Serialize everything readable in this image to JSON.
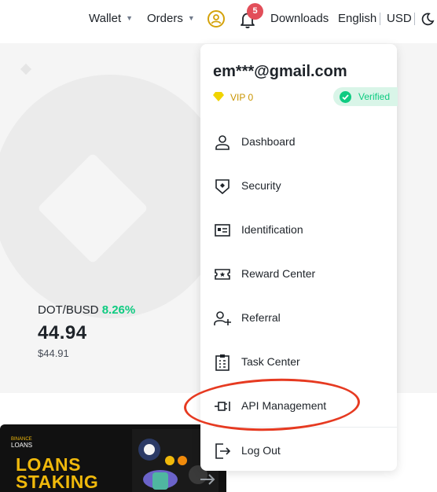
{
  "header": {
    "wallet_label": "Wallet",
    "orders_label": "Orders",
    "notification_count": "5",
    "downloads_label": "Downloads",
    "language_label": "English",
    "currency_label": "USD"
  },
  "market": {
    "pair": "DOT/BUSD",
    "change": "8.26%",
    "price": "44.94",
    "price_usd": "$44.91"
  },
  "promo": {
    "brand_top": "BINANCE",
    "brand_bottom": "LOANS",
    "title_line1": "LOANS",
    "title_line2": "STAKING"
  },
  "account_menu": {
    "email": "em***@gmail.com",
    "vip_label": "VIP 0",
    "verified_label": "Verified",
    "items": [
      {
        "label": "Dashboard",
        "icon": "user-icon"
      },
      {
        "label": "Security",
        "icon": "shield-icon"
      },
      {
        "label": "Identification",
        "icon": "id-card-icon"
      },
      {
        "label": "Reward Center",
        "icon": "ticket-icon"
      },
      {
        "label": "Referral",
        "icon": "user-add-icon"
      },
      {
        "label": "Task Center",
        "icon": "clipboard-icon"
      },
      {
        "label": "API Management",
        "icon": "api-plug-icon"
      }
    ],
    "logout_label": "Log Out"
  },
  "colors": {
    "accent": "#f0b90b",
    "positive": "#0ecb81",
    "badge": "#e24e59",
    "highlight": "#e63a21"
  }
}
